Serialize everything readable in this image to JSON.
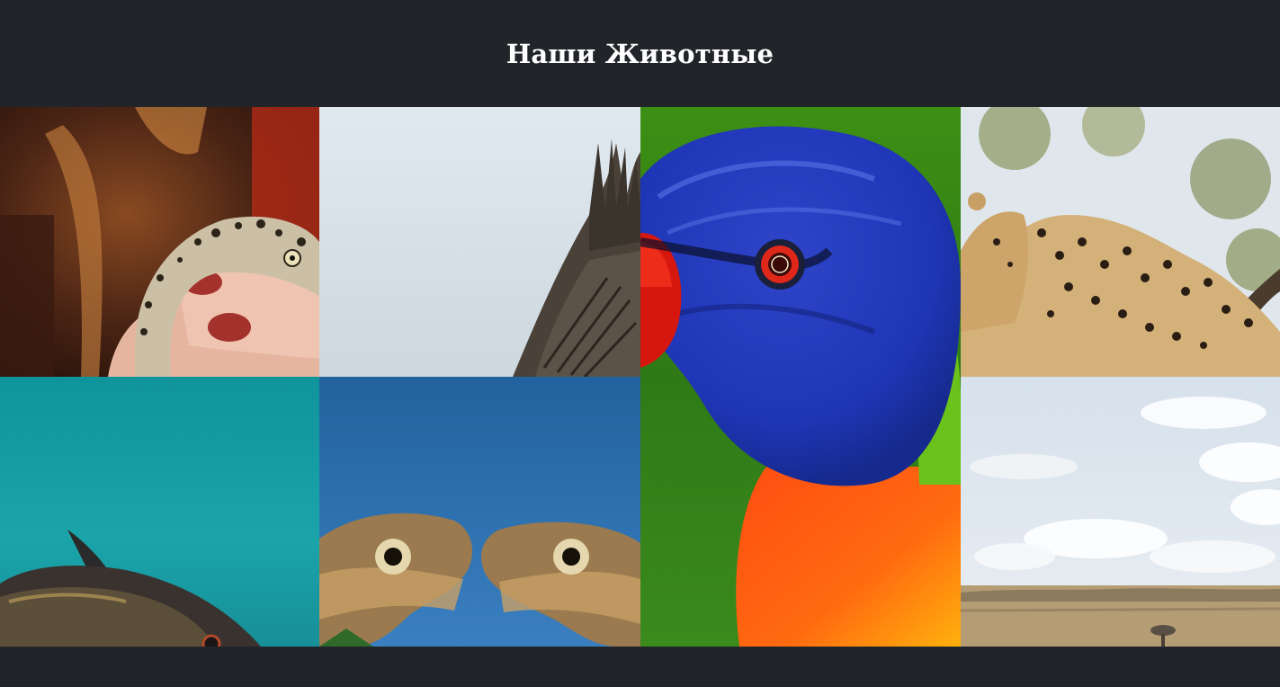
{
  "header": {
    "title": "Наши Животные"
  },
  "gallery": {
    "items": [
      {
        "name": "gecko-photo"
      },
      {
        "name": "bird-wing-photo"
      },
      {
        "name": "rainbow-lorikeet-photo"
      },
      {
        "name": "leopard-photo"
      },
      {
        "name": "fish-photo"
      },
      {
        "name": "lizards-photo"
      },
      {
        "name": "savanna-photo"
      }
    ]
  },
  "colors": {
    "background": "#212429",
    "title": "#ffffff"
  }
}
